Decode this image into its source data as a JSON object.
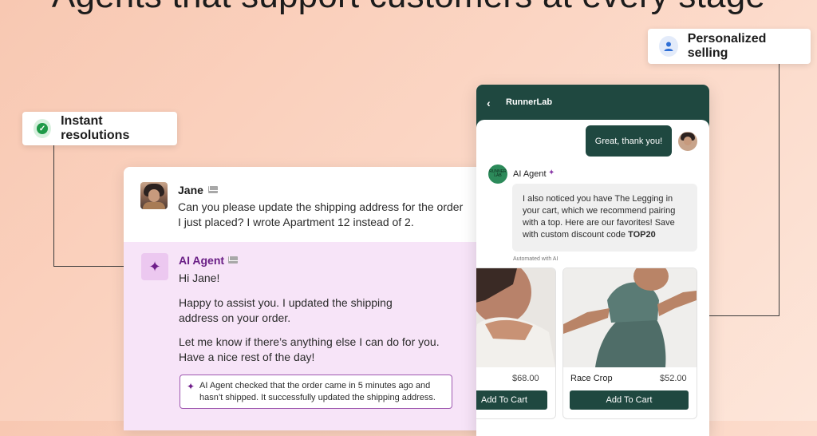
{
  "headline": "Agents that support customers at every stage",
  "badges": {
    "instant": "Instant resolutions",
    "personalized": "Personalized selling"
  },
  "email": {
    "customer_name": "Jane",
    "customer_message": "Can you please update the shipping address for the order I just placed? I wrote Apartment 12 instead of 2.",
    "agent_name": "AI Agent",
    "agent_greeting": "Hi Jane!",
    "agent_para1": "Happy to assist you. I updated the shipping address on your order.",
    "agent_para2": "Let me know if there’s anything else I can do for you. Have a nice rest of the day!",
    "agent_note": "AI Agent checked that the order came in 5 minutes ago and hasn’t shipped. It successfully updated the shipping address."
  },
  "chat": {
    "back_icon": "chevron-left",
    "brand": "RunnerLab",
    "user_message": "Great, thank you!",
    "agent_logo_text": "RUNNER LAB",
    "agent_name": "AI Agent",
    "agent_message_pre": "I also noticed you have The Legging in your cart, which we recommend pairing with a top. Here are our favorites! Save with custom discount code ",
    "agent_message_code": "TOP20",
    "automated_label": "Automated with AI",
    "products": [
      {
        "name": "",
        "price": "$68.00",
        "cta": "Add To Cart"
      },
      {
        "name": "Race Crop",
        "price": "$52.00",
        "cta": "Add To Cart"
      }
    ]
  }
}
